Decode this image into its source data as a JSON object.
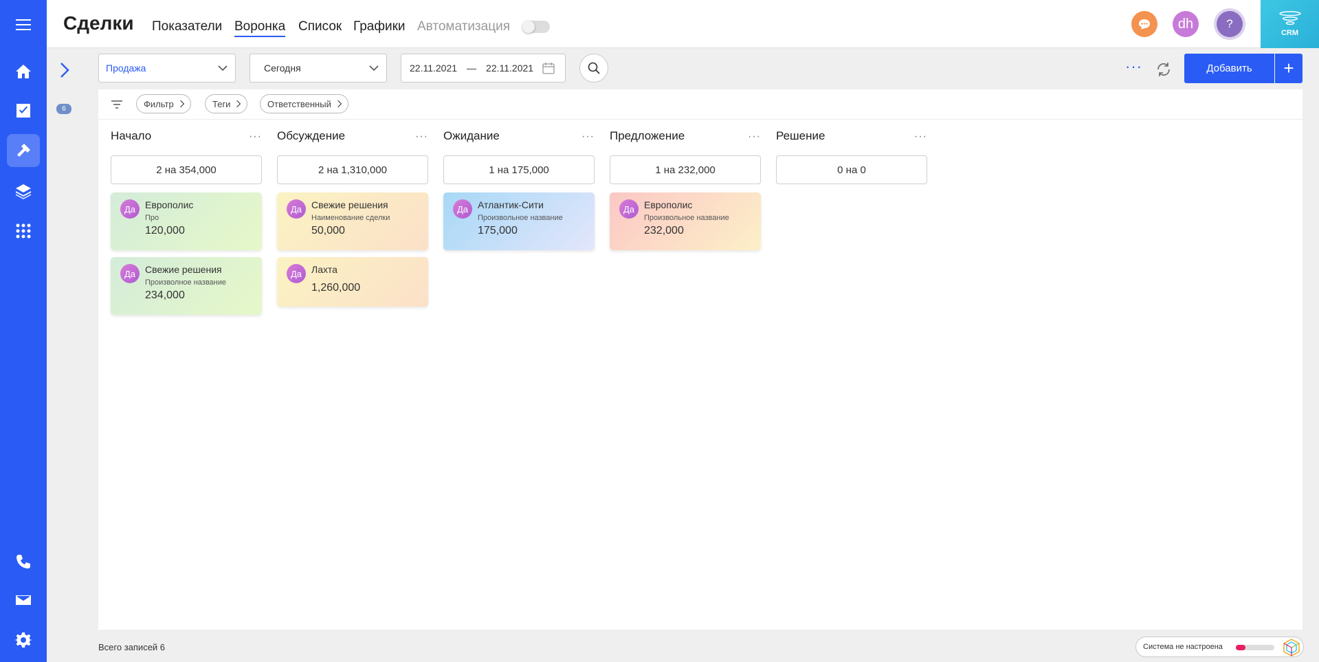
{
  "header": {
    "title": "Сделки",
    "tabs": [
      {
        "label": "Показатели"
      },
      {
        "label": "Воронка"
      },
      {
        "label": "Список"
      },
      {
        "label": "Графики"
      },
      {
        "label": "Автоматизация"
      }
    ],
    "user_initials": "dh",
    "help_label": "?",
    "crm_label": "CRM"
  },
  "toolbar": {
    "pipeline_select": "Продажа",
    "period_select": "Сегодня",
    "date_from": "22.11.2021",
    "date_separator": "—",
    "date_to": "22.11.2021",
    "more_label": "···",
    "add_label": "Добавить",
    "add_plus": "+"
  },
  "sidebar": {
    "counter": "6"
  },
  "filters": {
    "chips": [
      "Фильтр",
      "Теги",
      "Ответственный"
    ]
  },
  "columns": [
    {
      "title": "Начало",
      "summary": "2 на 354,000",
      "cards": [
        {
          "avatar": "Да",
          "name": "Европолис",
          "sub": "Про",
          "amount": "120,000",
          "gradient": [
            "#d4ecd9",
            "#e6f8c9"
          ]
        },
        {
          "avatar": "Да",
          "name": "Свежие решения",
          "sub": "Произволное название",
          "amount": "234,000",
          "gradient": [
            "#d4ecd9",
            "#e6f8c9"
          ]
        }
      ]
    },
    {
      "title": "Обсуждение",
      "summary": "2 на 1,310,000",
      "cards": [
        {
          "avatar": "Да",
          "name": "Свежие решения",
          "sub": "Наименование сделки",
          "amount": "50,000",
          "gradient": [
            "#fbf3c3",
            "#fbe0c8"
          ]
        },
        {
          "avatar": "Да",
          "name": "Лахта",
          "sub": "",
          "amount": "1,260,000",
          "gradient": [
            "#fbf3c3",
            "#fbe0c8"
          ]
        }
      ]
    },
    {
      "title": "Ожидание",
      "summary": "1 на 175,000",
      "cards": [
        {
          "avatar": "Да",
          "name": "Атлантик-Сити",
          "sub": "Произвольное название",
          "amount": "175,000",
          "gradient": [
            "#a7d8f6",
            "#e3e6fb"
          ]
        }
      ]
    },
    {
      "title": "Предложение",
      "summary": "1 на 232,000",
      "cards": [
        {
          "avatar": "Да",
          "name": "Европолис",
          "sub": "Произвольное название",
          "amount": "232,000",
          "gradient": [
            "#fbc8c6",
            "#fdf0c8"
          ]
        }
      ]
    },
    {
      "title": "Решение",
      "summary": "0 на 0",
      "cards": []
    }
  ],
  "column_menu": "···",
  "footer": {
    "total_records": "Всего записей 6",
    "system_status": "Система не настроена",
    "system_progress": 0.25
  },
  "colors": {
    "accent": "#2a5cf5",
    "chat_button": "#f4924f",
    "avatar_user": "#c77ad8",
    "help_button": "#8a6dc0"
  }
}
